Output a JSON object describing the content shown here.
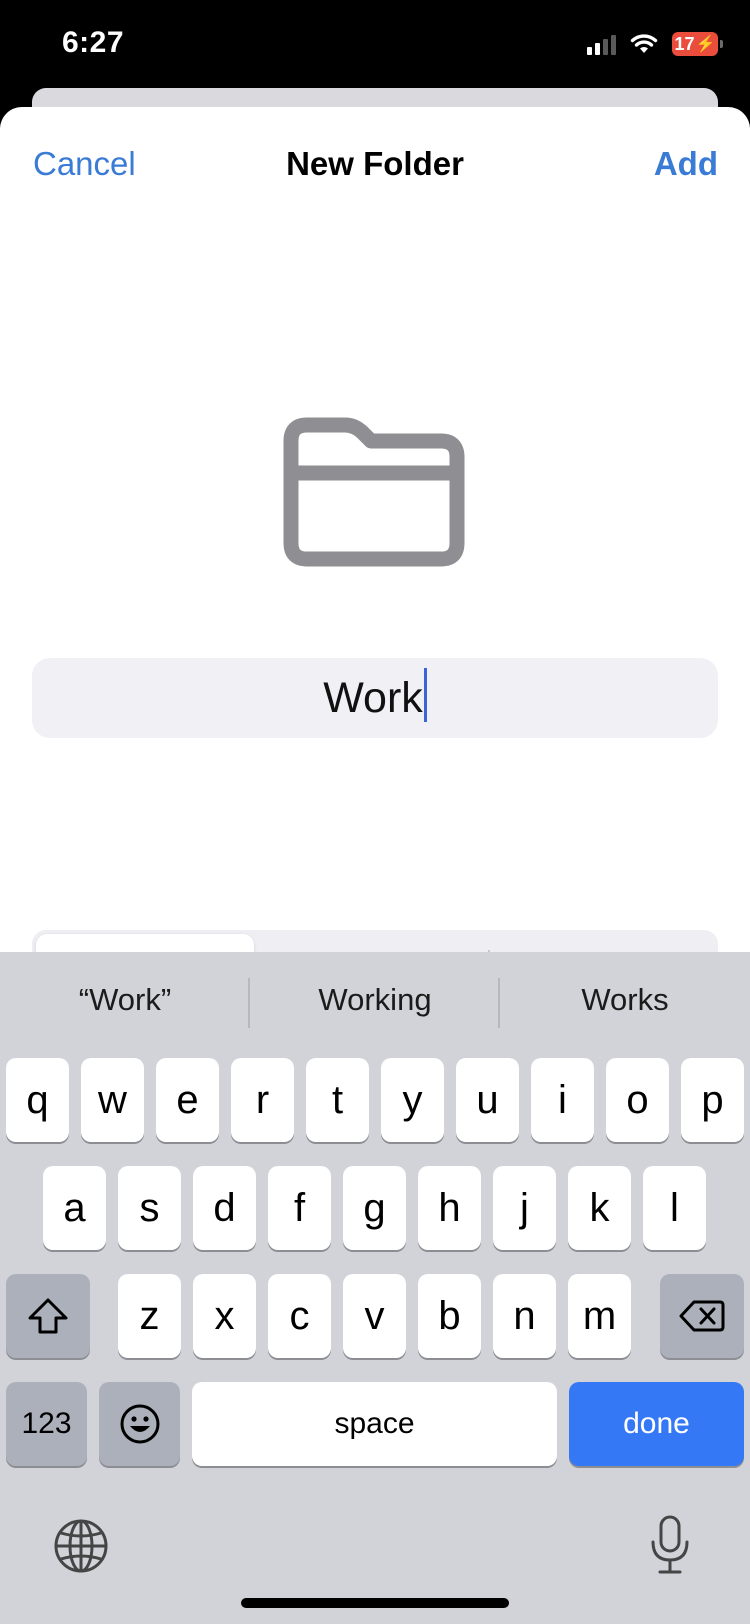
{
  "status_bar": {
    "time": "6:27",
    "battery": "17",
    "icons": [
      "cellular-signal-icon",
      "wifi-icon",
      "battery-charging-icon"
    ]
  },
  "nav": {
    "cancel": "Cancel",
    "title": "New Folder",
    "add": "Add"
  },
  "folder": {
    "icon": "folder-icon",
    "name_value": "Work"
  },
  "keyboard": {
    "suggestions": [
      "“Work”",
      "Working",
      "Works"
    ],
    "row1": [
      "q",
      "w",
      "e",
      "r",
      "t",
      "y",
      "u",
      "i",
      "o",
      "p"
    ],
    "row2": [
      "a",
      "s",
      "d",
      "f",
      "g",
      "h",
      "j",
      "k",
      "l"
    ],
    "row3": [
      "z",
      "x",
      "c",
      "v",
      "b",
      "n",
      "m"
    ],
    "numbers_label": "123",
    "space_label": "space",
    "done_label": "done",
    "icons": [
      "shift-icon",
      "delete-icon",
      "emoji-icon",
      "globe-icon",
      "microphone-icon"
    ]
  },
  "colors": {
    "accent": "#3a7bd5",
    "done_key": "#3478f6",
    "caret": "#3a64d8",
    "battery_low": "#eb4d3d"
  }
}
